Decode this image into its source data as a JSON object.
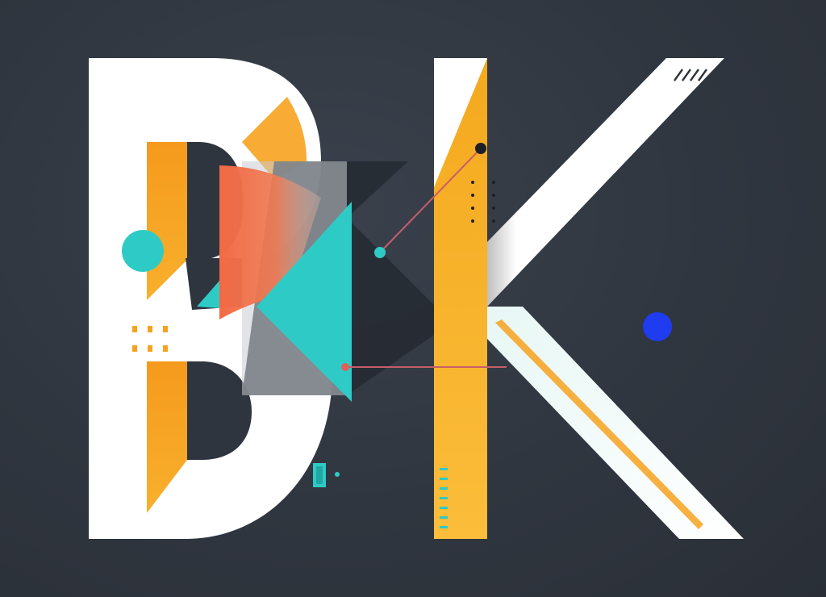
{
  "artwork": {
    "letters": [
      "B",
      "K"
    ],
    "colors": {
      "background": "#2f353f",
      "letter_white": "#ffffff",
      "orange": "#f7a21f",
      "amber": "#f8b428",
      "teal": "#2ecbc6",
      "coral": "#f06a4a",
      "gray_panel": "#b9bec4",
      "dark_triangle": "#262b33",
      "blue_dot": "#1f3cf0",
      "connector_line": "#c65e6a",
      "black_dot": "#1d1f24"
    },
    "decorations": [
      "teal-circle",
      "blue-circle",
      "connector-lines",
      "orange-dot-grid",
      "teal-dash-stack",
      "hatch-marks",
      "vertical-dot-column"
    ]
  }
}
